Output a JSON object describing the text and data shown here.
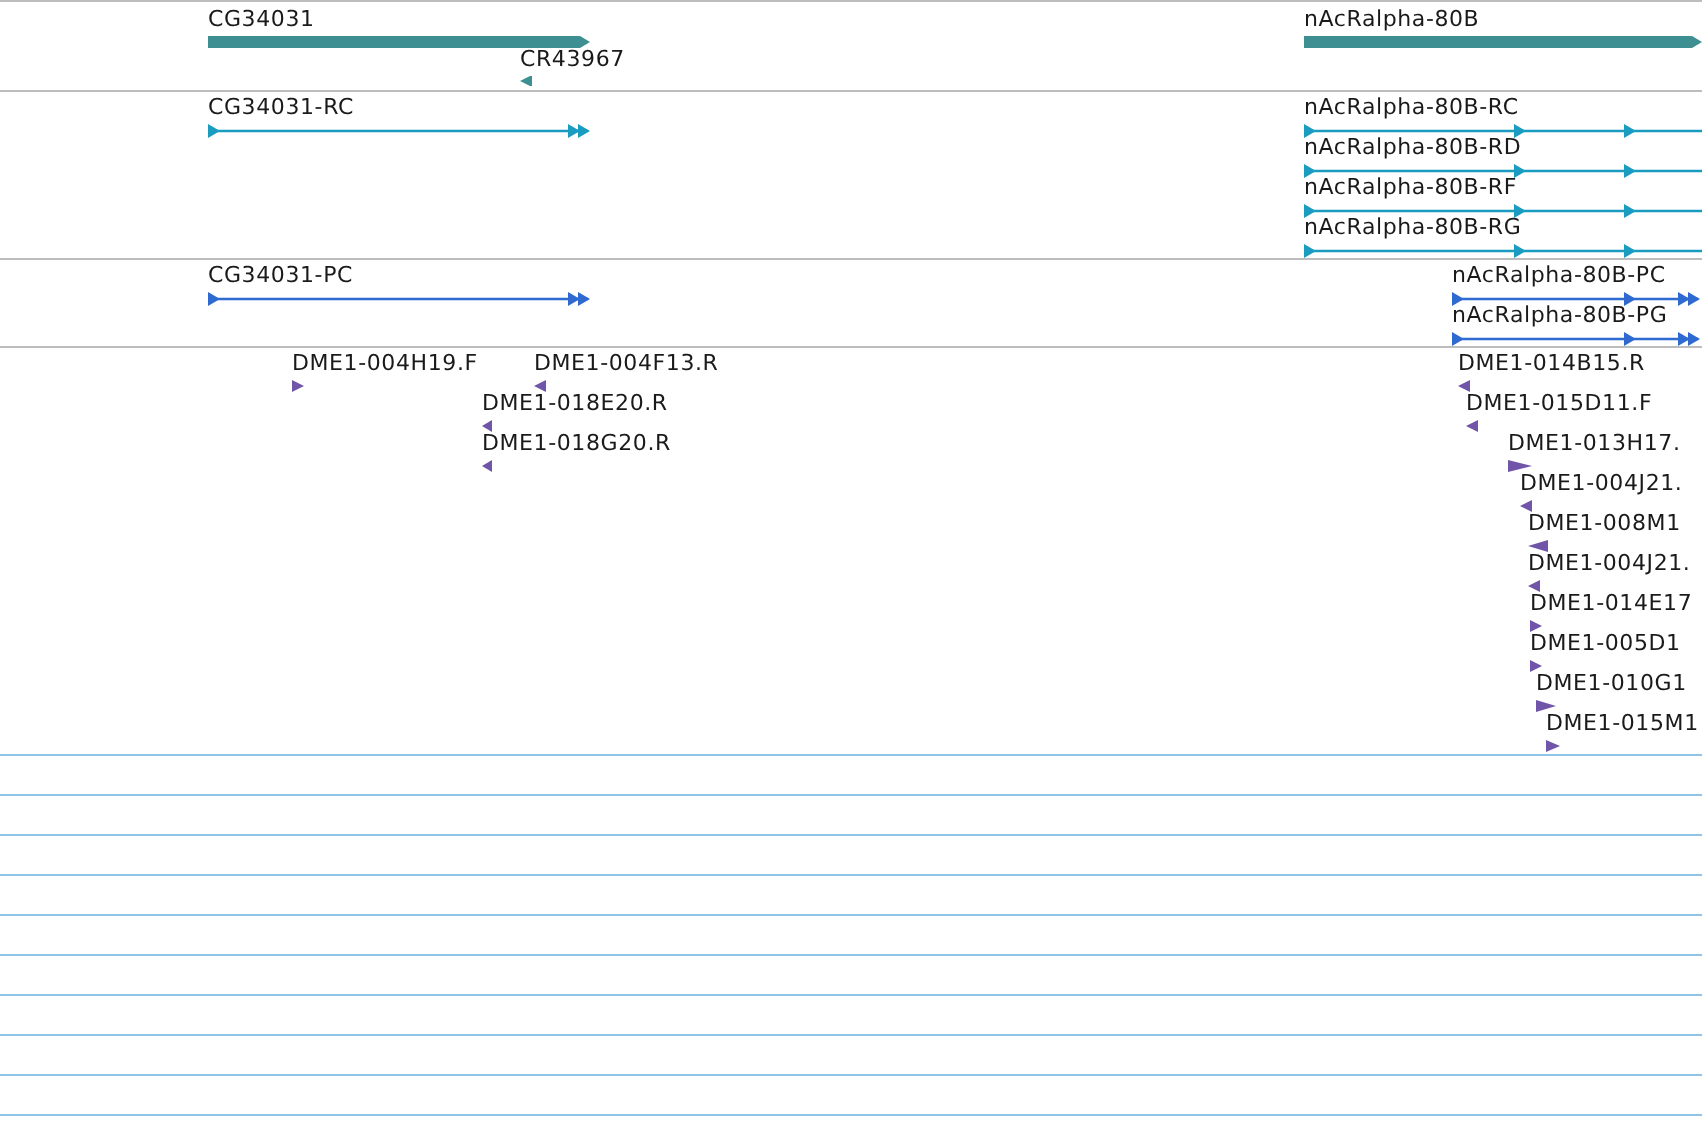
{
  "tracks": [
    {
      "kind": "genes",
      "features": [
        {
          "label": "CG34031",
          "reverse": false
        },
        {
          "label": "CR43967",
          "reverse": true
        },
        {
          "label": "nAcRalpha-80B",
          "reverse": false
        }
      ]
    },
    {
      "kind": "transcripts",
      "features": [
        {
          "label": "CG34031-RC",
          "reverse": false
        },
        {
          "label": "nAcRalpha-80B-RC",
          "reverse": false
        },
        {
          "label": "nAcRalpha-80B-RD",
          "reverse": false
        },
        {
          "label": "nAcRalpha-80B-RF",
          "reverse": false
        },
        {
          "label": "nAcRalpha-80B-RG",
          "reverse": false
        }
      ]
    },
    {
      "kind": "proteins",
      "features": [
        {
          "label": "CG34031-PC",
          "reverse": false
        },
        {
          "label": "nAcRalpha-80B-PC",
          "reverse": false
        },
        {
          "label": "nAcRalpha-80B-PG",
          "reverse": false
        }
      ]
    },
    {
      "kind": "reads",
      "features": [
        {
          "label": "DME1-004H19.F",
          "reverse": false
        },
        {
          "label": "DME1-004F13.R",
          "reverse": true
        },
        {
          "label": "DME1-018E20.R",
          "reverse": true
        },
        {
          "label": "DME1-018G20.R",
          "reverse": true
        },
        {
          "label": "DME1-014B15.R",
          "reverse": true
        },
        {
          "label": "DME1-015D11.F",
          "reverse": true
        },
        {
          "label": "DME1-013H17.",
          "reverse": false
        },
        {
          "label": "DME1-004J21.",
          "reverse": true
        },
        {
          "label": "DME1-008M1",
          "reverse": true
        },
        {
          "label": "DME1-004J21.",
          "reverse": true
        },
        {
          "label": "DME1-014E17",
          "reverse": false
        },
        {
          "label": "DME1-005D1",
          "reverse": false
        },
        {
          "label": "DME1-010G1",
          "reverse": false
        },
        {
          "label": "DME1-015M1",
          "reverse": false
        }
      ]
    }
  ]
}
